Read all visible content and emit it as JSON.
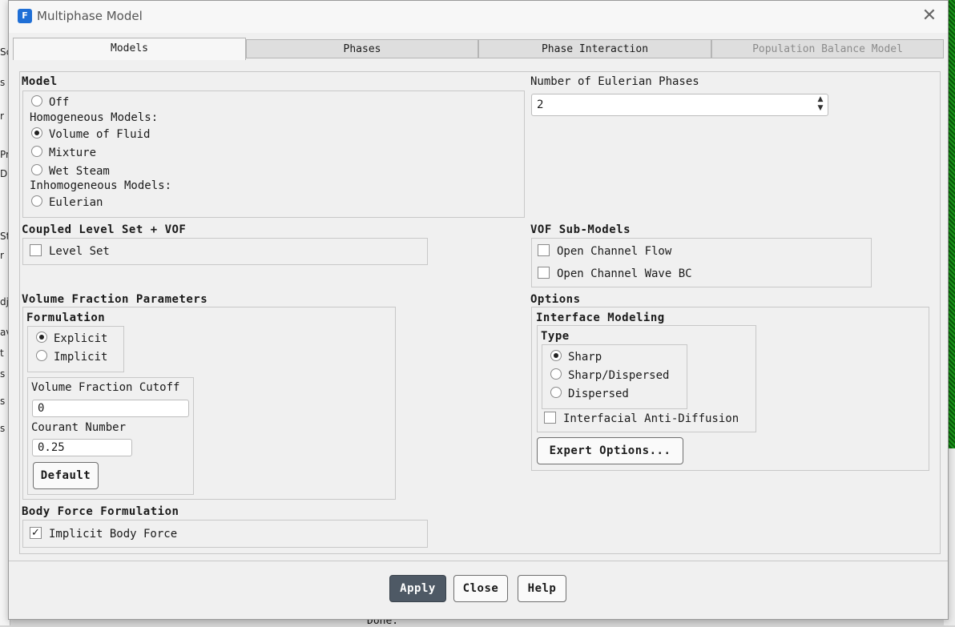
{
  "window": {
    "title": "Multiphase Model",
    "app_icon": "F"
  },
  "background": {
    "left_fragments": [
      "Sc",
      "s",
      "r",
      "Pr",
      "De",
      "St",
      "r",
      "dj",
      "av",
      "t",
      "s",
      "s",
      "s"
    ],
    "console_text": "Done."
  },
  "tabs": [
    {
      "label": "Models",
      "state": "active"
    },
    {
      "label": "Phases",
      "state": "normal"
    },
    {
      "label": "Phase Interaction",
      "state": "normal"
    },
    {
      "label": "Population Balance Model",
      "state": "disabled"
    }
  ],
  "model": {
    "title": "Model",
    "off_label": "Off",
    "homogeneous_label": "Homogeneous Models:",
    "vof_label": "Volume of Fluid",
    "mixture_label": "Mixture",
    "wet_steam_label": "Wet Steam",
    "inhomogeneous_label": "Inhomogeneous Models:",
    "eulerian_label": "Eulerian",
    "selected": "Volume of Fluid"
  },
  "eulerian_phases": {
    "title": "Number of Eulerian Phases",
    "value": "2"
  },
  "coupled_level_set": {
    "title": "Coupled Level Set + VOF",
    "level_set_label": "Level Set",
    "level_set_checked": false
  },
  "vof_sub_models": {
    "title": "VOF Sub-Models",
    "open_channel_flow_label": "Open Channel Flow",
    "open_channel_wave_bc_label": "Open Channel Wave BC",
    "open_channel_flow_checked": false,
    "open_channel_wave_bc_checked": false
  },
  "volume_fraction": {
    "title": "Volume Fraction Parameters",
    "formulation_title": "Formulation",
    "explicit_label": "Explicit",
    "implicit_label": "Implicit",
    "selected": "Explicit",
    "cutoff_label": "Volume Fraction Cutoff",
    "cutoff_value": "0",
    "courant_label": "Courant Number",
    "courant_value": "0.25",
    "default_button": "Default"
  },
  "options": {
    "title": "Options",
    "interface_modeling_title": "Interface Modeling",
    "type_title": "Type",
    "sharp_label": "Sharp",
    "sharp_dispersed_label": "Sharp/Dispersed",
    "dispersed_label": "Dispersed",
    "selected": "Sharp",
    "anti_diffusion_label": "Interfacial Anti-Diffusion",
    "anti_diffusion_checked": false,
    "expert_button": "Expert Options..."
  },
  "body_force": {
    "title": "Body Force Formulation",
    "implicit_label": "Implicit Body Force",
    "implicit_checked": true,
    "check_glyph": "✓"
  },
  "footer": {
    "apply_label": "Apply",
    "close_label": "Close",
    "help_label": "Help"
  }
}
